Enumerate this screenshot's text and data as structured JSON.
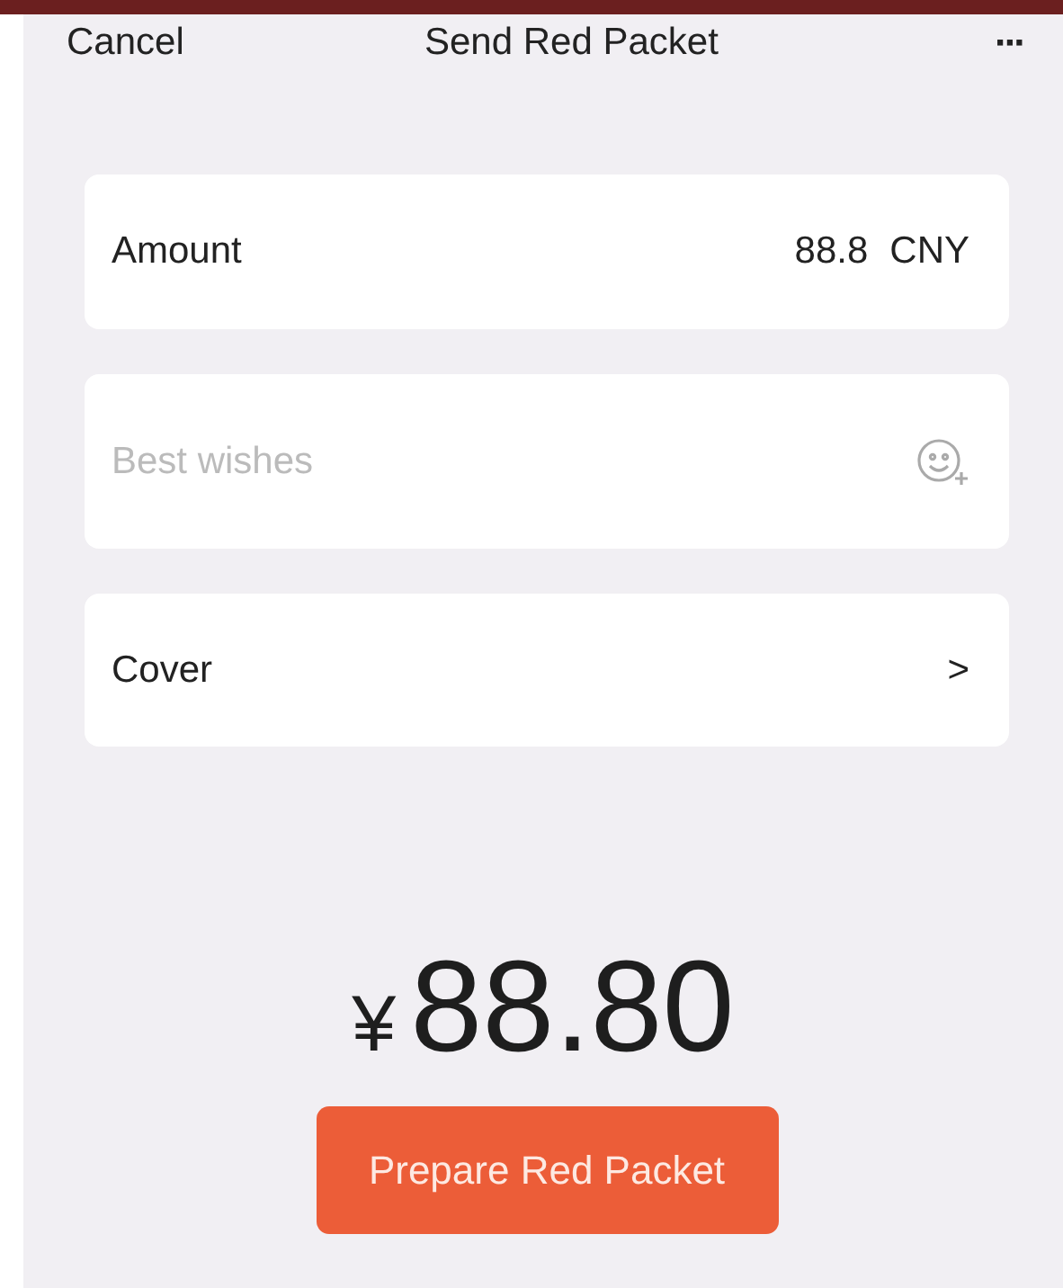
{
  "nav": {
    "cancel": "Cancel",
    "title": "Send Red Packet",
    "more": "···"
  },
  "amount_row": {
    "label": "Amount",
    "value": "88.8",
    "unit": "CNY"
  },
  "message_field": {
    "placeholder": "Best wishes"
  },
  "cover_row": {
    "label": "Cover",
    "chevron": ">"
  },
  "total": {
    "currency": "¥",
    "amount": "88.80"
  },
  "submit_button": "Prepare Red Packet"
}
